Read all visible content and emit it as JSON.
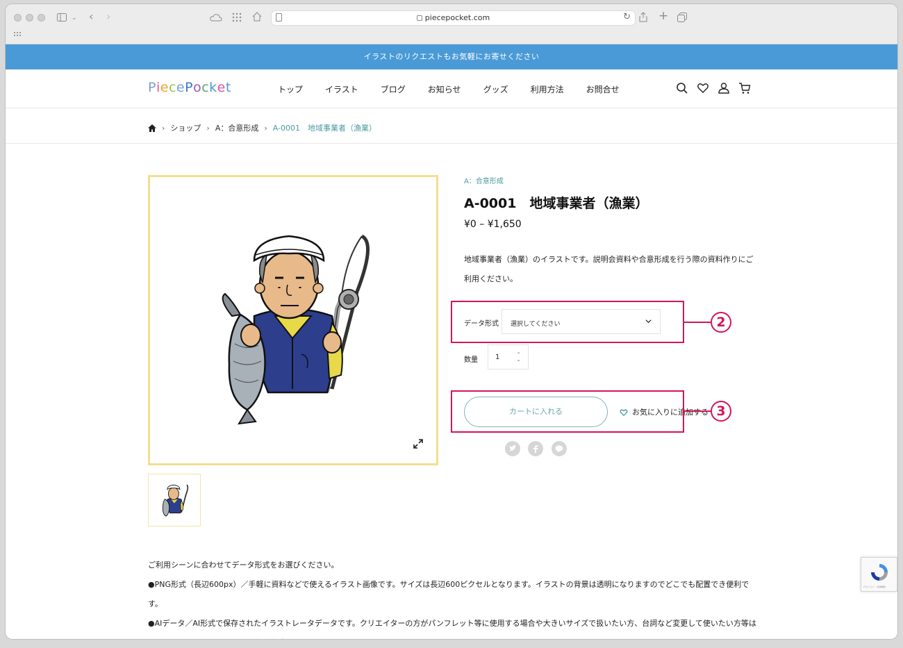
{
  "browser": {
    "url": "piecepocket.com"
  },
  "announcement": "イラストのリクエストもお気軽にお寄せください",
  "header": {
    "logo_letters": [
      "P",
      "i",
      "e",
      "c",
      "e",
      "P",
      "o",
      "c",
      "k",
      "e",
      "t"
    ],
    "nav": [
      "トップ",
      "イラスト",
      "ブログ",
      "お知らせ",
      "グッズ",
      "利用方法",
      "お問合せ"
    ],
    "icons": [
      "search-icon",
      "heart-icon",
      "user-icon",
      "cart-icon"
    ]
  },
  "breadcrumb": {
    "items": [
      "ショップ",
      "A：合意形成"
    ],
    "current": "A-0001　地域事業者（漁業）"
  },
  "product": {
    "category": "A：合意形成",
    "title": "A-0001　地域事業者（漁業）",
    "price": "¥0 – ¥1,650",
    "description": "地域事業者（漁業）のイラストです。説明会資料や合意形成を行う際の資料作りにご利用ください。",
    "format_label": "データ形式",
    "format_placeholder": "選択してください",
    "qty_label": "数量",
    "qty_value": "1",
    "cart_button": "カートに入れる",
    "favorite_label": "お気に入りに追加する"
  },
  "annotations": [
    "2",
    "3"
  ],
  "body_lines": [
    "ご利用シーンに合わせてデータ形式をお選びください。",
    "●PNG形式（長辺600px）／手軽に資料などで使えるイラスト画像です。サイズは長辺600ピクセルとなります。イラストの背景は透明になりますのでどこでも配置でき便利です。",
    "●AIデータ／AI形式で保存されたイラストレータデータです。クリエイターの方がパンフレット等に使用する場合や大きいサイズで扱いたい方、台詞など変更して使いたい方等はこちらのイラストレーターから加工作成してください。"
  ],
  "recaptcha_text": "プライバシー・利用規約",
  "colors": {
    "announce_bar": "#4a9ad7",
    "accent_teal": "#4a9aa0",
    "image_border": "#f4de8e",
    "annotation": "#d4145a",
    "logo": [
      "#7a9fd4",
      "#e0559a",
      "#f0a030",
      "#9ac84a",
      "#7a9fd4",
      "#3a7ac4",
      "#9b59b6",
      "#5aaa6a",
      "#4a9ad7",
      "#e0559a",
      "#4a9ad7"
    ]
  }
}
